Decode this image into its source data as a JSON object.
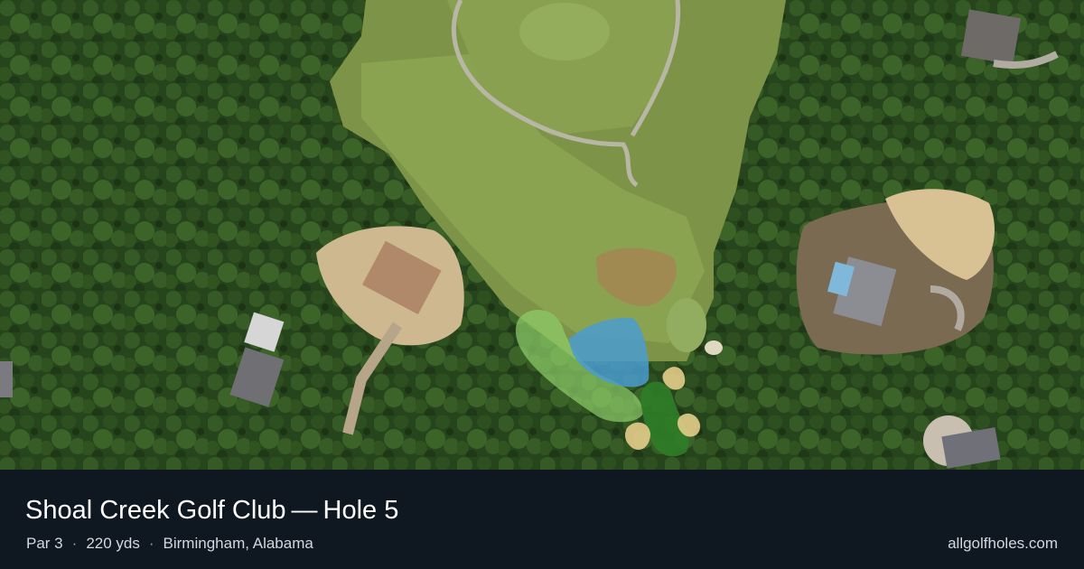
{
  "hole": {
    "club": "Shoal Creek Golf Club",
    "separator": "—",
    "hole_label": "Hole 5",
    "par": "Par 3",
    "yardage": "220 yds",
    "location": "Birmingham, Alabama",
    "dot": "·"
  },
  "site": "allgolfholes.com",
  "colors": {
    "tee": "#8fcf6a",
    "water": "#4a9ccf",
    "green": "#2f7d28",
    "bunker": "#e3cc8a",
    "footer": "#0f1721"
  }
}
